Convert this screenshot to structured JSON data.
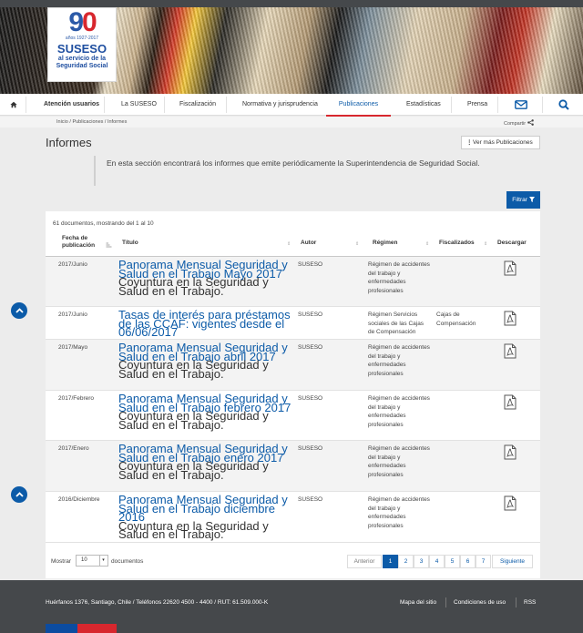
{
  "logo": {
    "number_9": "9",
    "number_0": "0",
    "years_label": "años",
    "years_range": "1927-2017",
    "brand": "SUSESO",
    "tagline_1": "al servicio de la",
    "tagline_2": "Seguridad Social"
  },
  "nav": {
    "home_icon": "home-icon",
    "items": [
      "Atención usuarios",
      "La SUSESO",
      "Fiscalización",
      "Normativa y jurisprudencia",
      "Publicaciones",
      "Estadísticas",
      "Prensa"
    ],
    "active": "Publicaciones"
  },
  "breadcrumb": {
    "inicio": "Inicio",
    "publicaciones": "Publicaciones",
    "informes": "Informes",
    "sep": "/",
    "share": "Compartir"
  },
  "page": {
    "title": "Informes",
    "more_button": "Ver más Publicaciones",
    "intro": "En esta sección encontrará los informes que emite periódicamente la Superintendencia de Seguridad Social.",
    "filter_button": "Filtrar"
  },
  "table": {
    "count_text": "61 documentos, mostrando del 1 al 10",
    "headers": {
      "fecha_1": "Fecha de",
      "fecha_2": "publicación",
      "titulo": "Título",
      "autor": "Autor",
      "regimen": "Régimen",
      "fiscalizados": "Fiscalizados",
      "descargar": "Descargar"
    },
    "rows": [
      {
        "fecha": "2017/Junio",
        "titulo": "Panorama Mensual Seguridad y Salud en el Trabajo Mayo 2017",
        "sub": "Coyuntura en la Seguridad y Salud en el Trabajo.",
        "autor": "SUSESO",
        "regimen": "Régimen de accidentes del trabajo y enfermedades profesionales",
        "fiscalizados": ""
      },
      {
        "fecha": "2017/Junio",
        "titulo": "Tasas de interés para préstamos de las CCAF: vigentes desde el 06/06/2017",
        "sub": "",
        "autor": "SUSESO",
        "regimen": "Régimen Servicios sociales de las Cajas de Compensación",
        "fiscalizados": "Cajas de Compensación"
      },
      {
        "fecha": "2017/Mayo",
        "titulo": "Panorama Mensual Seguridad y Salud en el Trabajo abril 2017",
        "sub": "Coyuntura en la Seguridad y Salud en el Trabajo.",
        "autor": "SUSESO",
        "regimen": "Régimen de accidentes del trabajo y enfermedades profesionales",
        "fiscalizados": ""
      },
      {
        "fecha": "2017/Febrero",
        "titulo": "Panorama Mensual Seguridad y Salud en el Trabajo febrero 2017",
        "sub": "Coyuntura en la Seguridad y Salud en el Trabajo.",
        "autor": "SUSESO",
        "regimen": "Régimen de accidentes del trabajo y enfermedades profesionales",
        "fiscalizados": ""
      },
      {
        "fecha": "2017/Enero",
        "titulo": "Panorama Mensual Seguridad y Salud en el Trabajo enero 2017",
        "sub": "Coyuntura en la Seguridad y Salud en el Trabajo.",
        "autor": "SUSESO",
        "regimen": "Régimen de accidentes del trabajo y enfermedades profesionales",
        "fiscalizados": ""
      },
      {
        "fecha": "2016/Diciembre",
        "titulo": "Panorama Mensual Seguridad y Salud en el Trabajo diciembre 2016",
        "sub": "Coyuntura en la Seguridad y Salud en el Trabajo.",
        "autor": "SUSESO",
        "regimen": "Régimen de accidentes del trabajo y enfermedades profesionales",
        "fiscalizados": ""
      }
    ]
  },
  "pager": {
    "show_label": "Mostrar",
    "show_value": "10",
    "show_suffix": "documentos",
    "prev": "Anterior",
    "pages": [
      "1",
      "2",
      "3",
      "4",
      "5",
      "6",
      "7"
    ],
    "current": "1",
    "next": "Siguiente"
  },
  "footer": {
    "address": "Huérfanos 1376, Santiago, Chile / Teléfonos 22620 4500 - 4400 / RUT: 61.509.000-K",
    "links": [
      "Mapa del sitio",
      "Condiciones de uso",
      "RSS"
    ]
  }
}
